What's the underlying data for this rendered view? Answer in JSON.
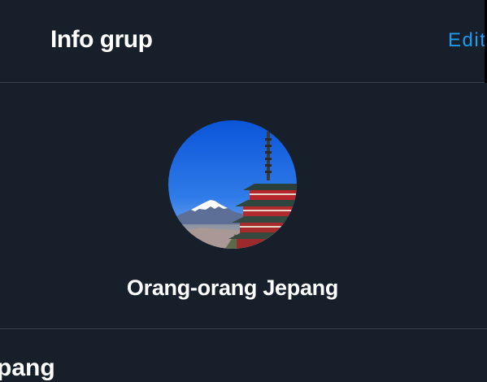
{
  "header": {
    "title": "Info grup",
    "edit_label": "Edit"
  },
  "group": {
    "name": "Orang-orang Jepang",
    "avatar_icon": "mount-fuji-pagoda-photo"
  },
  "section": {
    "title_partial": "pang"
  },
  "colors": {
    "background": "#17202a",
    "accent": "#1d9bf0",
    "divider": "#38444d",
    "text": "#ffffff"
  }
}
